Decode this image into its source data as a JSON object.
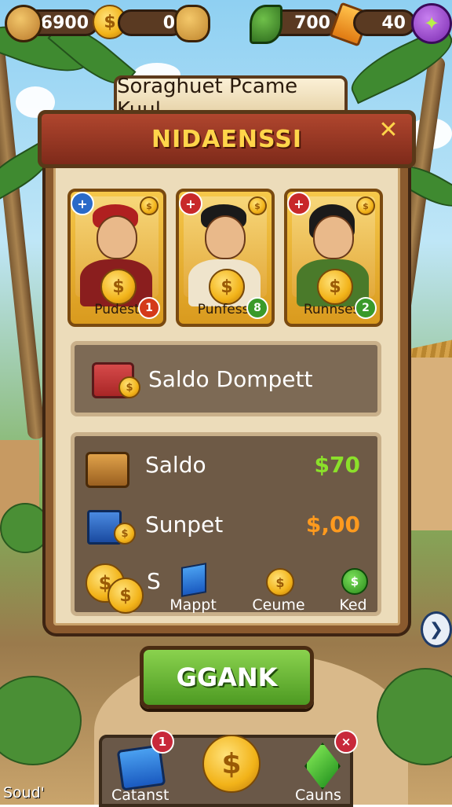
{
  "hud": {
    "coins_value": "6900",
    "currency2_value": "0",
    "leaf_value": "700",
    "gems_value": "40"
  },
  "panel": {
    "title": "Soraghuet Pcame Kuul",
    "banner": "NIDAENSSI"
  },
  "characters": [
    {
      "label": "Pudest",
      "number": "1",
      "flag": "+"
    },
    {
      "label": "Punfessi",
      "number": "8",
      "flag": "+"
    },
    {
      "label": "Runnsesi",
      "number": "2",
      "flag": "+"
    }
  ],
  "wallet": {
    "label": "Saldo Dompett"
  },
  "balance": {
    "rows": [
      {
        "label": "Saldo",
        "value": "$70"
      },
      {
        "label": "Sunpet",
        "value": "$,00"
      }
    ],
    "coin_row_label": "S",
    "options": [
      {
        "label": "Mappt"
      },
      {
        "label": "Ceume"
      },
      {
        "label": "Ked"
      }
    ]
  },
  "action_button": {
    "label": "GGANK"
  },
  "dock": {
    "left_label": "Catanst",
    "right_label": "Cauns",
    "left_badge": "1",
    "right_badge": "×",
    "center_coin": "$"
  },
  "corner_label": "Soud'",
  "colors": {
    "green_value": "#8be02a",
    "orange_value": "#ff9a1e",
    "banner_text": "#ffd54a"
  }
}
